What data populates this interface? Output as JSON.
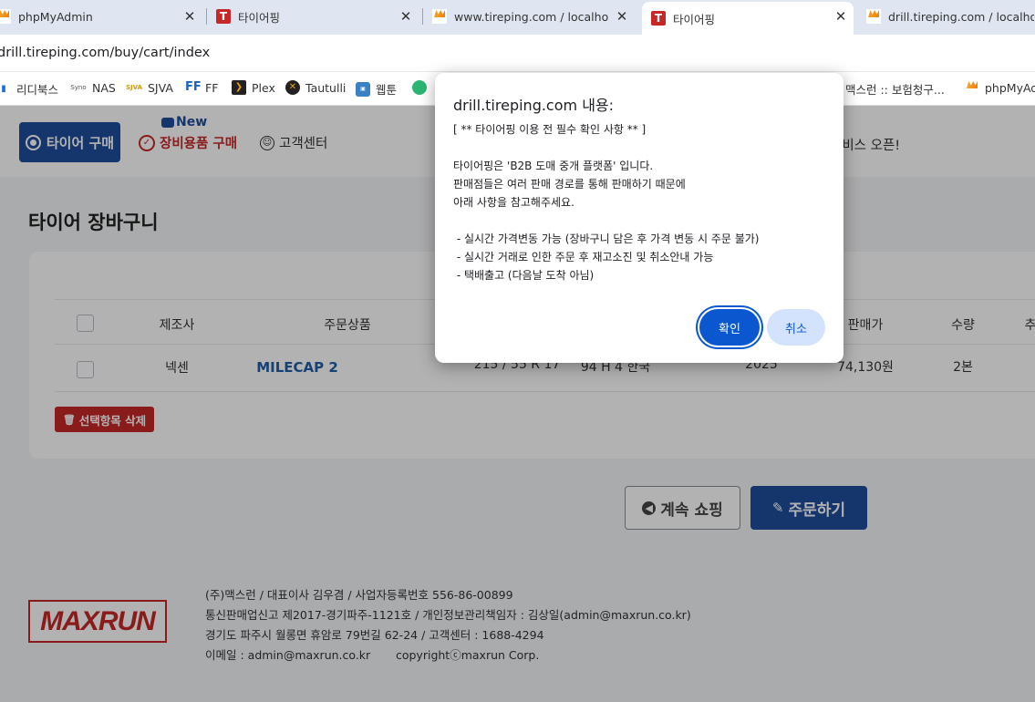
{
  "browser": {
    "tabs": [
      {
        "title": "phpMyAdmin",
        "icon": "phpmyadmin-icon",
        "active": false
      },
      {
        "title": "타이어핑",
        "icon": "tireping-icon",
        "active": false
      },
      {
        "title": "www.tireping.com / localhost /",
        "icon": "phpmyadmin-icon",
        "active": false
      },
      {
        "title": "타이어핑",
        "icon": "tireping-icon",
        "active": true
      },
      {
        "title": "drill.tireping.com / localhost /",
        "icon": "phpmyadmin-icon",
        "active": false
      }
    ],
    "url": "drill.tireping.com/buy/cart/index",
    "bookmarks": [
      {
        "label": "리디북스",
        "icon": "ridibooks-icon"
      },
      {
        "label": "NAS",
        "icon": "synology-icon"
      },
      {
        "label": "SJVA",
        "icon": "sjva-icon"
      },
      {
        "label": "FF",
        "icon": "ff-icon"
      },
      {
        "label": "Plex",
        "icon": "plex-icon"
      },
      {
        "label": "Tautulli",
        "icon": "tautulli-icon"
      },
      {
        "label": "웹툰",
        "icon": "webtoon-icon"
      },
      {
        "label": "맥스런 :: 보험청구...",
        "icon": "bookmark-icon"
      },
      {
        "label": "phpMyAdmin",
        "icon": "phpmyadmin-icon"
      }
    ]
  },
  "site": {
    "nav": {
      "tire_buy": "타이어 구매",
      "new_badge": "New",
      "parts_buy": "장비용품 구매",
      "customer_center": "고객센터",
      "promo": "서비스 오픈!"
    },
    "page_title": "타이어 장바구니",
    "table": {
      "headers": [
        "제조사",
        "주문상품",
        "판매가",
        "수량",
        "추"
      ],
      "rows": [
        {
          "maker": "넥센",
          "product": "MILECAP 2",
          "size": "215 / 55 R 17",
          "spec": "94 H 4 한국",
          "year": "2025",
          "price": "74,130원",
          "qty": "2본"
        }
      ]
    },
    "delete_selected": "선택항목 삭제",
    "continue_shopping": "계속 쇼핑",
    "order": "주문하기",
    "footer": {
      "logo": "MAXRUN",
      "line1": "(주)맥스런 / 대표이사 김우겸 / 사업자등록번호 556-86-00899",
      "line2": "통신판매업신고 제2017-경기파주-1121호 / 개인정보관리책임자 : 김상일(admin@maxrun.co.kr)",
      "line3": "경기도 파주시 월롱면 휴암로 79번길 62-24 / 고객센터 : 1688-4294",
      "line4": "이메일 : admin@maxrun.co.kr       copyrightⓒmaxrun Corp."
    }
  },
  "dialog": {
    "title": "drill.tireping.com 내용:",
    "message": "[ ** 타이어핑 이용 전 필수 확인 사항 ** ]\n\n타이어핑은 'B2B 도매 중개 플랫폼' 입니다.\n판매점들은 여러 판매 경로를 통해 판매하기 때문에\n아래 사항을 참고해주세요.\n\n - 실시간 가격변동 가능 (장바구니 담은 후 가격 변동 시 주문 불가)\n - 실시간 거래로 인한 주문 후 재고소진 및 취소안내 가능\n - 택배출고 (다음날 도착 아님)",
    "ok": "확인",
    "cancel": "취소"
  },
  "colors": {
    "brand_blue": "#1f4e9c",
    "brand_red": "#c62828",
    "dialog_button": "#0b57d0"
  }
}
